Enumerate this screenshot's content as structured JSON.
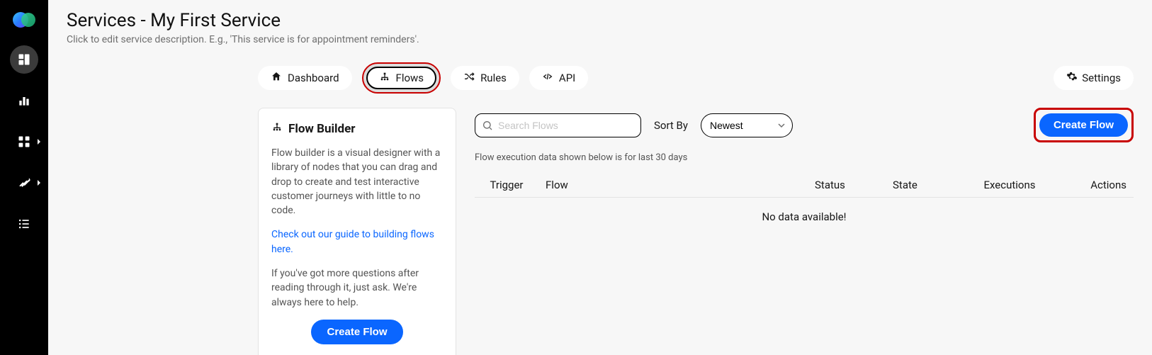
{
  "header": {
    "title": "Services - My First Service",
    "subtitle": "Click to edit service description. E.g., 'This service is for appointment reminders'."
  },
  "tabs": {
    "dashboard": "Dashboard",
    "flows": "Flows",
    "rules": "Rules",
    "api": "API",
    "settings": "Settings"
  },
  "builder": {
    "title": "Flow Builder",
    "p1": "Flow builder is a visual designer with a library of nodes that you can drag and drop to create and test interactive customer journeys with little to no code.",
    "guide": "Check out our guide to building flows here.",
    "p2": "If you've got more questions after reading through it, just ask. We're always here to help.",
    "button": "Create Flow"
  },
  "toolbar": {
    "search_placeholder": "Search Flows",
    "sortby_label": "Sort By",
    "sort_value": "Newest",
    "create_flow": "Create Flow"
  },
  "flows": {
    "hint": "Flow execution data shown below is for last 30 days",
    "cols": {
      "trigger": "Trigger",
      "flow": "Flow",
      "status": "Status",
      "state": "State",
      "executions": "Executions",
      "actions": "Actions"
    },
    "empty": "No data available!"
  }
}
